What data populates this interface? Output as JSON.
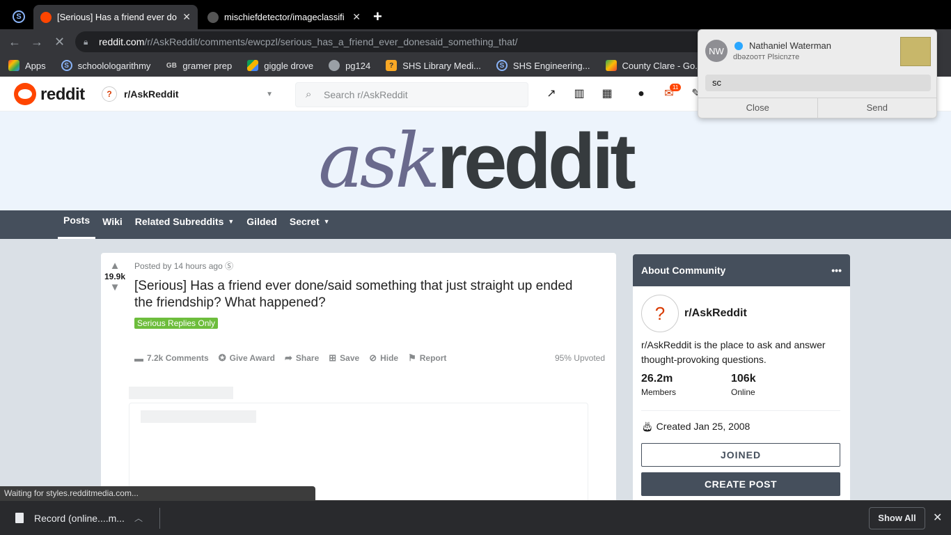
{
  "browser": {
    "tabs": [
      {
        "title": "[Serious] Has a friend ever don",
        "active": true
      },
      {
        "title": "mischiefdetector/imageclassifi",
        "active": false
      }
    ],
    "new_tab": "+",
    "url_host": "reddit.com",
    "url_path": "/r/AskReddit/comments/ewcpzl/serious_has_a_friend_ever_donesaid_something_that/",
    "bookmarks": [
      {
        "label": "Apps",
        "icon": "apps-grid-icon"
      },
      {
        "label": "schoolologarithmy",
        "icon": "schoology-icon"
      },
      {
        "label": "gramer prep",
        "icon": "gb-icon"
      },
      {
        "label": "giggle drove",
        "icon": "drive-icon"
      },
      {
        "label": "pg124",
        "icon": "globe-icon"
      },
      {
        "label": "SHS Library Medi...",
        "icon": "library-icon"
      },
      {
        "label": "SHS Engineering...",
        "icon": "schoology-icon"
      },
      {
        "label": "County Clare - Go...",
        "icon": "maps-icon"
      }
    ],
    "status_text": "Waiting for styles.redditmedia.com...",
    "download": {
      "name": "Record (online....m...",
      "show_all": "Show All"
    }
  },
  "reddit": {
    "wordmark": "reddit",
    "subreddit": "r/AskReddit",
    "search_placeholder": "Search r/AskReddit",
    "mail_badge": "11",
    "banner_ask": "ask",
    "banner_reddit": "reddit",
    "subnav": [
      "Posts",
      "Wiki",
      "Related Subreddits",
      "Gilded",
      "Secret"
    ],
    "post": {
      "score": "19.9k",
      "meta": "Posted by 14 hours ago",
      "title": "[Serious] Has a friend ever done/said something that just straight up ended the friendship? What happened?",
      "flair": "Serious Replies Only",
      "actions": {
        "comments": "7.2k Comments",
        "award": "Give Award",
        "share": "Share",
        "save": "Save",
        "hide": "Hide",
        "report": "Report"
      },
      "upvoted": "95% Upvoted"
    },
    "sidebar": {
      "header": "About Community",
      "name": "r/AskReddit",
      "description": "r/AskReddit is the place to ask and answer thought-provoking questions.",
      "members_value": "26.2m",
      "members_label": "Members",
      "online_value": "106k",
      "online_label": "Online",
      "created": "Created Jan 25, 2008",
      "joined_label": "JOINED",
      "create_label": "CREATE POST"
    }
  },
  "notification": {
    "initials": "NW",
    "sender": "Nathaniel Waterman",
    "subtitle": "dbəzooтт Plsicnzтe",
    "reply_value": "sc",
    "close_label": "Close",
    "send_label": "Send"
  }
}
